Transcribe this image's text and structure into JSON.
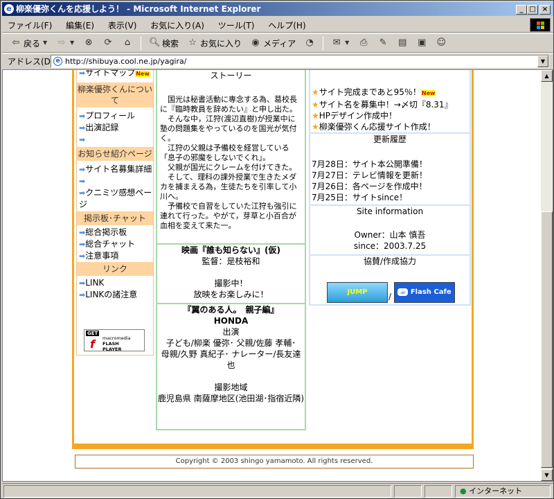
{
  "window": {
    "title": "柳楽優弥くんを応援しよう！ - Microsoft Internet Explorer",
    "minimize": "_",
    "maximize": "□",
    "close": "×"
  },
  "menu": [
    "ファイル(F)",
    "編集(E)",
    "表示(V)",
    "お気に入り(A)",
    "ツール(T)",
    "ヘルプ(H)"
  ],
  "toolbar": {
    "back": "戻る",
    "search": "検索",
    "favorites": "お気に入り",
    "media": "メディア"
  },
  "address": {
    "label": "アドレス(D)",
    "url": "http://shibuya.cool.ne.jp/yagira/"
  },
  "left": {
    "top_item": "サイトマップ",
    "new_badge": "New",
    "sections": [
      {
        "head": "柳楽優弥くんについて",
        "items": [
          "プロフィール",
          "出演記録",
          ""
        ]
      },
      {
        "head": "お知らせ紹介ページ",
        "items": [
          "サイト名募集詳細",
          "",
          "クニミツ感想ページ"
        ]
      },
      {
        "head": "掲示板･チャット",
        "items": [
          "総合掲示板",
          "総合チャット",
          "注意事項"
        ]
      },
      {
        "head": "リンク",
        "items": [
          "LINK",
          "LINKの諸注意"
        ]
      }
    ],
    "flash": {
      "get": "GET",
      "brand": "macromedia",
      "product1": "FLASH",
      "product2": "PLAYER"
    }
  },
  "middle": {
    "story_title": "ストーリー",
    "story": [
      "　国光は秘書活動に専念する為、葛校長に『臨時教員を辞めたい』と申し出た。",
      "　そんな中，江狩(渡辺直樹)が授業中に塾の問題集をやっているのを国光が気付く。",
      "　江狩の父親は予備校を経営している「息子の邪魔をしないでくれ」。",
      "　父親が国光にクレームを付けてきた。",
      "　そして、理科の課外授業で生きたメダカを捕まえる為，生徒たちを引率して小川へ。",
      "　予備校で自習をしていた江狩も強引に連れて行った。やがて，芽草と小百合が血相を変えて来た一。"
    ],
    "movie": {
      "title": "映画『誰も知らない』(仮)",
      "director": "監督：是枝裕和",
      "line1": "撮影中！",
      "line2": "放映をお楽しみに！"
    },
    "cm": {
      "title": "『翼のある人。　親子編』",
      "sponsor": "HONDA",
      "cast_head": "出演",
      "cast": "子ども/柳楽 優弥･ 父親/佐藤 孝輔･",
      "cast2": "母親/久野 真紀子･ ナレーター/長友達也",
      "loc_head": "撮影地域",
      "loc": "鹿児島県 南薩摩地区(池田湖･指宿近隣)"
    }
  },
  "right": {
    "news": [
      "サイト完成まであと95％！",
      "サイト名を募集中！→〆切『8.31』",
      "HPデザイン作成中！",
      "柳楽優弥くん応援サイト作成！"
    ],
    "new_badge": "New",
    "history_title": "更新履歴",
    "history": [
      "7月28日：サイト本公開準備！",
      "7月27日：テレビ情報を更新！",
      "7月26日：各ページを作成中！",
      "7月25日：サイトsince！"
    ],
    "info_title": "Site information",
    "owner": "Owner：山本 慎吾",
    "since": "since：2003.7.25",
    "coop_title": "協賛/作成協力",
    "banner1": "JUMP",
    "banner2": "Flash Cafe",
    "slash": "/"
  },
  "footer": "Copyright © 2003 shingo yamamoto. All rights reserved.",
  "status": {
    "zone": "インターネット"
  },
  "colors": {
    "accent": "#f5a623",
    "left_head": "#ffd4a0",
    "mid_border": "#a8d8a8",
    "right_border": "#cfe3f7"
  }
}
